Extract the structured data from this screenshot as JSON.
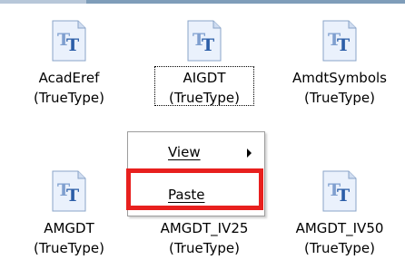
{
  "fonts": [
    {
      "name": "AcadEref",
      "type": "(TrueType)",
      "icon": "truetype-font-icon"
    },
    {
      "name": "AIGDT",
      "type": "(TrueType)",
      "icon": "truetype-font-icon"
    },
    {
      "name": "AmdtSymbols",
      "type": "(TrueType)",
      "icon": "truetype-font-icon"
    },
    {
      "name": "AMGDT",
      "type": "(TrueType)",
      "icon": "truetype-font-icon"
    },
    {
      "name": "AMGDT_IV25",
      "type": "(TrueType)",
      "icon": "truetype-font-icon"
    },
    {
      "name": "AMGDT_IV50",
      "type": "(TrueType)",
      "icon": "truetype-font-icon"
    }
  ],
  "context_menu": {
    "items": [
      {
        "label": "View",
        "accelerator": "V",
        "has_submenu": true
      },
      {
        "label": "Paste",
        "accelerator": "P",
        "has_submenu": false
      }
    ]
  },
  "colors": {
    "highlight": "#e8201e",
    "icon_page": "#e9f0fb",
    "icon_letters": "#2c5ea8"
  }
}
